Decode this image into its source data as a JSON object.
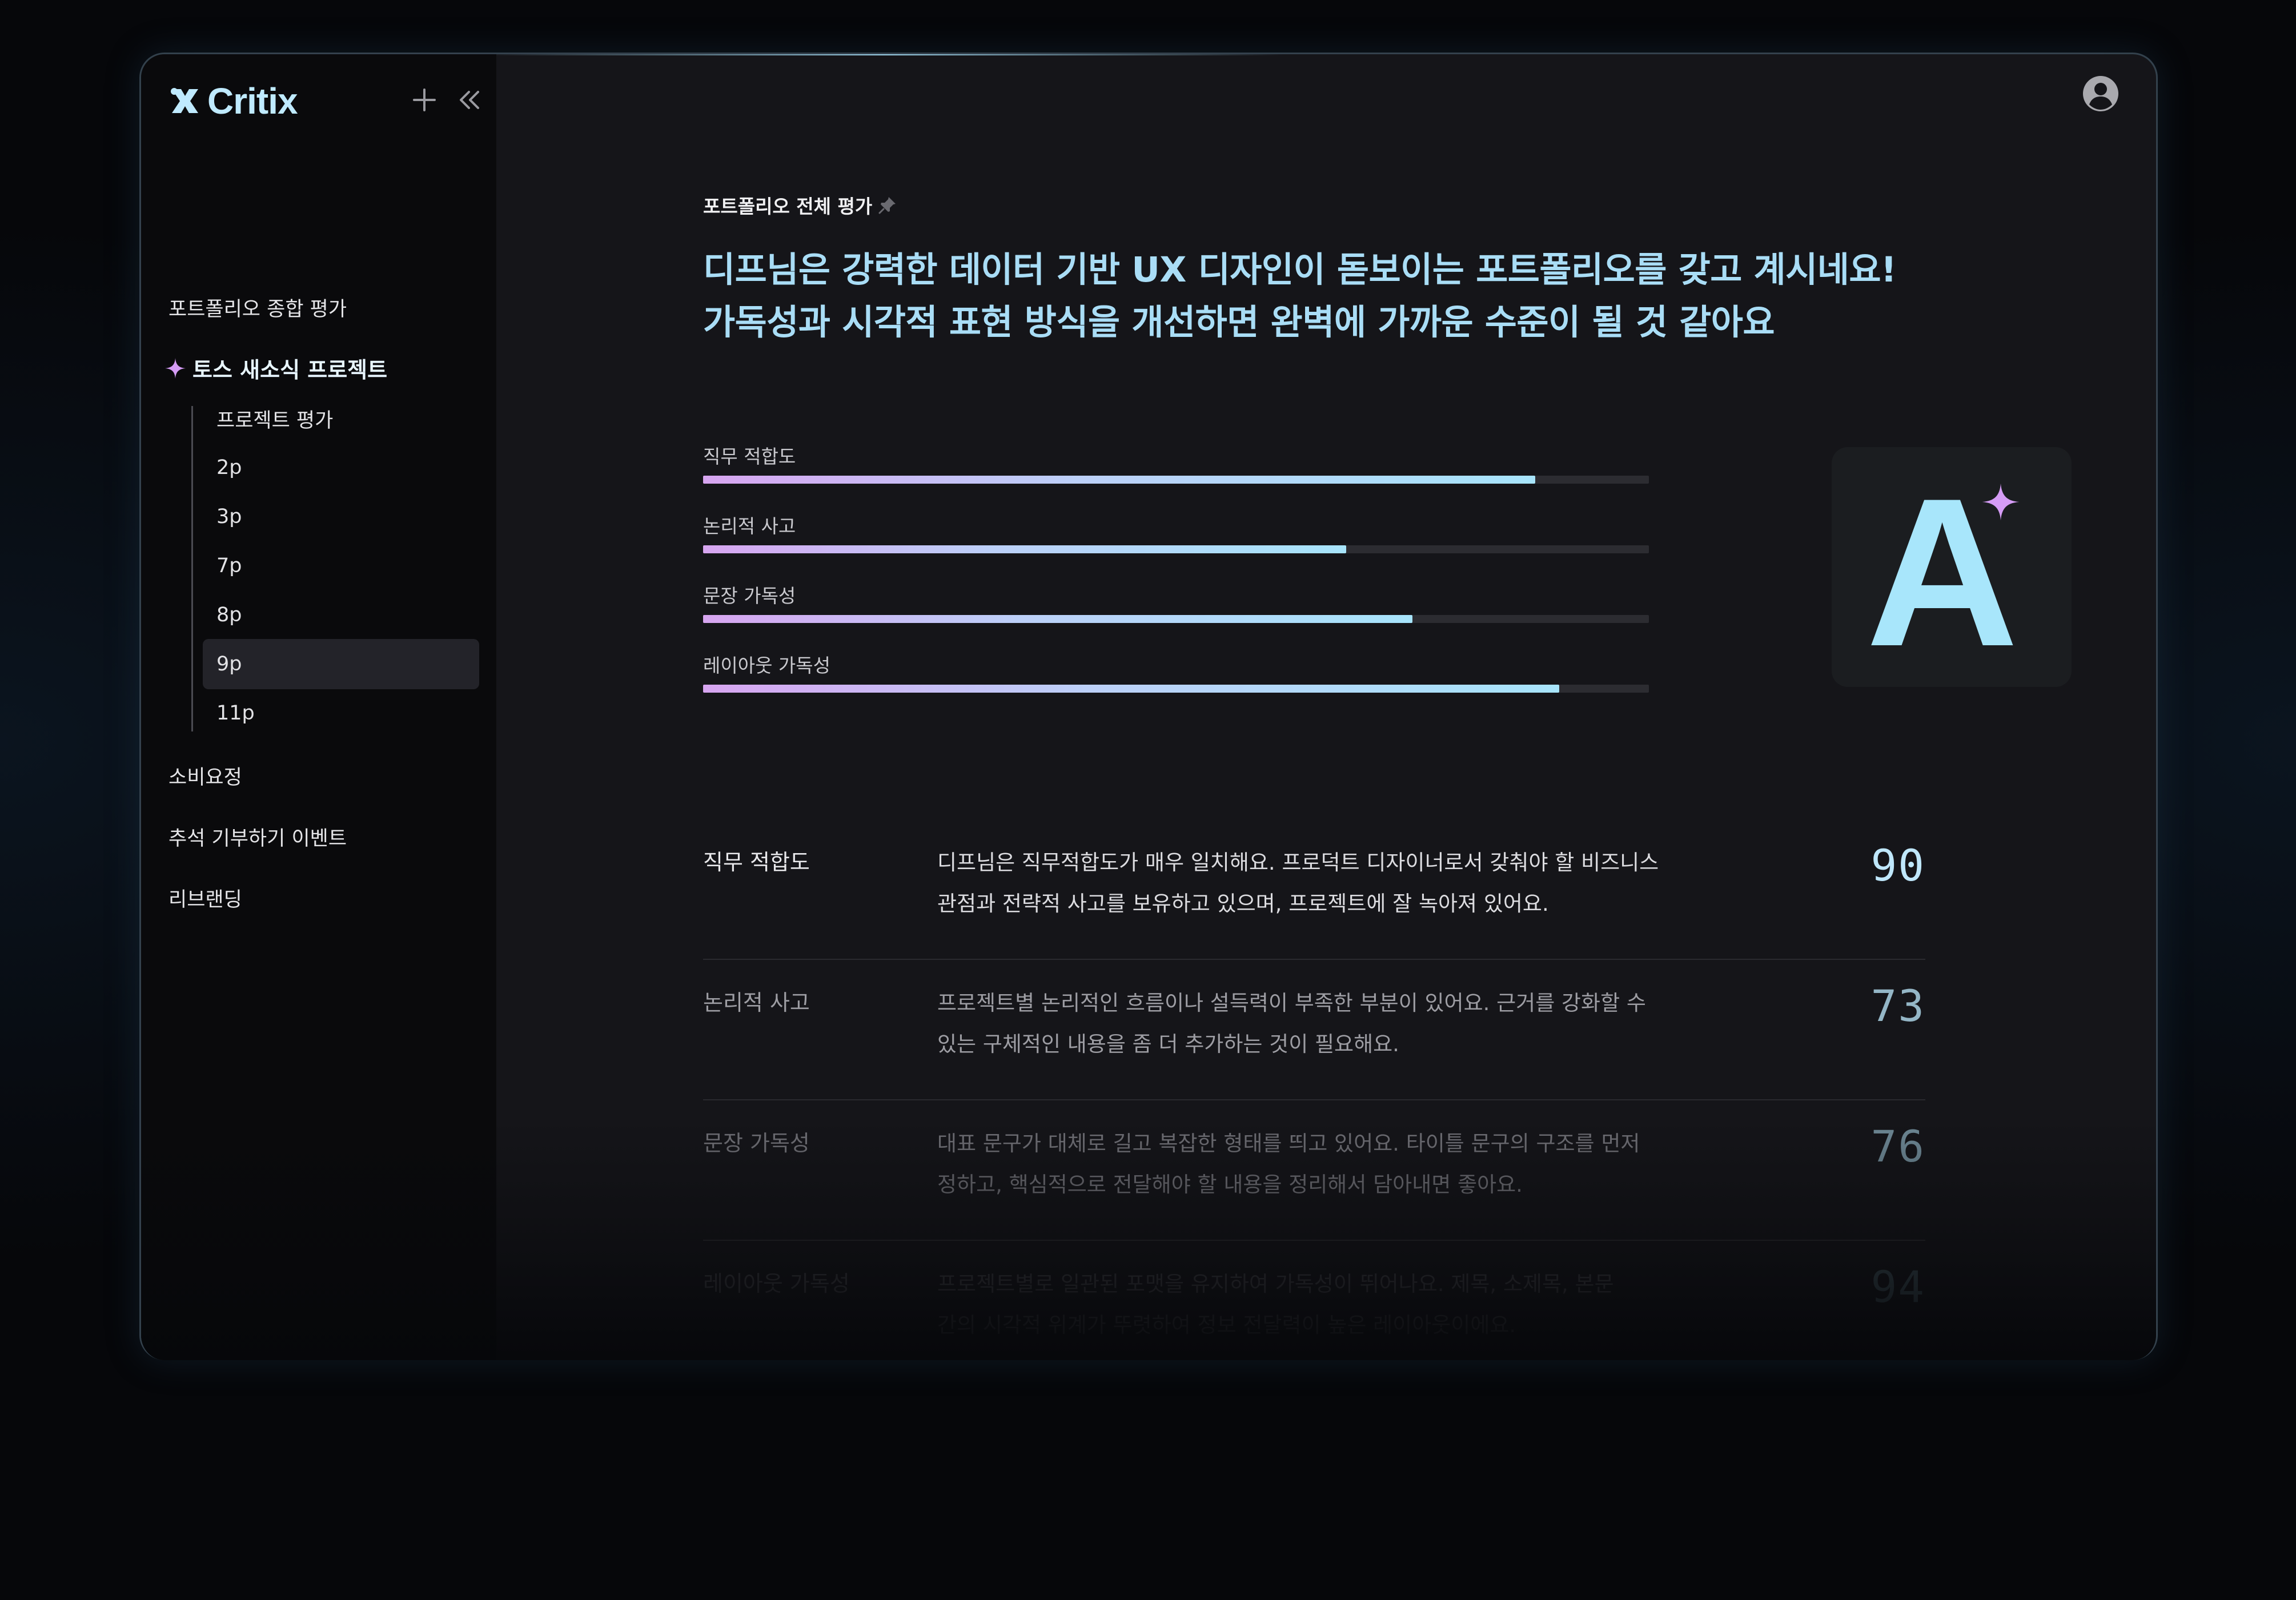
{
  "app": {
    "name": "Critix"
  },
  "sidebar": {
    "items": [
      {
        "label": "포트폴리오 종합 평가"
      },
      {
        "label": "토스 새소식 프로젝트",
        "active": true
      },
      {
        "label": "소비요정"
      },
      {
        "label": "추석 기부하기 이벤트"
      },
      {
        "label": "리브랜딩"
      }
    ],
    "sub_items": [
      {
        "label": "프로젝트 평가"
      },
      {
        "label": "2p"
      },
      {
        "label": "3p"
      },
      {
        "label": "7p"
      },
      {
        "label": "8p"
      },
      {
        "label": "9p",
        "selected": true
      },
      {
        "label": "11p"
      }
    ]
  },
  "main": {
    "eyebrow": "포트폴리오 전체 평가",
    "headline_line1": "디프님은 강력한 데이터 기반 UX 디자인이 돋보이는 포트폴리오를 갖고 계시네요!",
    "headline_line2": "가독성과 시각적 표현 방식을 개선하면 완벽에 가까운 수준이 될 것 같아요",
    "bars": [
      {
        "label": "직무 적합도",
        "fraction": 0.88
      },
      {
        "label": "논리적 사고",
        "fraction": 0.68
      },
      {
        "label": "문장 가독성",
        "fraction": 0.75
      },
      {
        "label": "레이아웃 가독성",
        "fraction": 0.905
      }
    ],
    "grade": "A",
    "rows": [
      {
        "title": "직무 적합도",
        "desc_line1": "디프님은 직무적합도가 매우 일치해요. 프로덕트 디자이너로서 갖춰야 할 비즈니스",
        "desc_line2": "관점과 전략적 사고를 보유하고 있으며, 프로젝트에 잘 녹아져 있어요.",
        "score": "90"
      },
      {
        "title": "논리적 사고",
        "desc_line1": "프로젝트별 논리적인 흐름이나 설득력이 부족한 부분이 있어요. 근거를 강화할 수",
        "desc_line2": "있는 구체적인 내용을 좀 더 추가하는 것이 필요해요.",
        "score": "73"
      },
      {
        "title": "문장 가독성",
        "desc_line1": "대표 문구가 대체로 길고 복잡한 형태를 띄고 있어요. 타이틀 문구의 구조를 먼저",
        "desc_line2": "정하고, 핵심적으로 전달해야 할 내용을 정리해서 담아내면 좋아요.",
        "score": "76"
      },
      {
        "title": "레이아웃 가독성",
        "desc_line1": "프로젝트별로 일관된 포맷을 유지하여 가독성이 뛰어나요. 제목, 소제목, 본문",
        "desc_line2": "간의 시각적 위계가 뚜렷하여 정보 전달력이 높은 레이아웃이에요.",
        "score": "94"
      }
    ]
  },
  "icons": {
    "logo": "critix-logo-icon",
    "add": "plus-icon",
    "collapse": "double-chevron-left-icon",
    "account": "user-circle-icon",
    "pin": "pin-icon",
    "sparkle": "sparkle-icon"
  },
  "colors": {
    "accent": "#a9ddf6",
    "sparkle": "#d59cf5",
    "bar_gradient_start": "#d7a5f0",
    "bar_gradient_end": "#a7e4fb"
  }
}
